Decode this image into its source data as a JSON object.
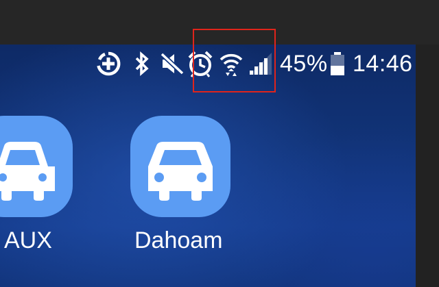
{
  "status_bar": {
    "icons": [
      "data-saver-icon",
      "bluetooth-icon",
      "mute-icon",
      "alarm-icon",
      "wifi-icon",
      "signal-icon",
      "battery-icon"
    ],
    "battery_percent": "45%",
    "time": "14:46"
  },
  "home_screen": {
    "apps": [
      {
        "label": "AUX",
        "icon": "car-icon"
      },
      {
        "label": "Dahoam",
        "icon": "car-icon"
      }
    ]
  },
  "colors": {
    "app_icon_background": "#5b9cf3",
    "highlight_border": "#e0241b",
    "wallpaper": "#12357d"
  }
}
